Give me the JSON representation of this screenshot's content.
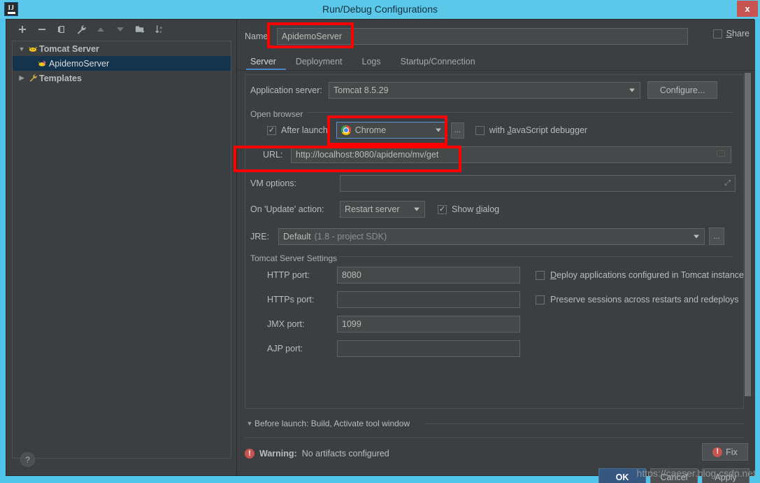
{
  "window": {
    "title": "Run/Debug Configurations",
    "app_icon": "intellij-idea-icon",
    "close_label": "x"
  },
  "left_panel": {
    "toolbar": [
      {
        "name": "add-configuration-button",
        "glyph": "+"
      },
      {
        "name": "remove-configuration-button",
        "glyph": "−"
      },
      {
        "name": "copy-configuration-button",
        "glyph": "copy-icon"
      },
      {
        "name": "edit-templates-button",
        "glyph": "wrench-icon"
      },
      {
        "name": "move-up-button",
        "glyph": "▲"
      },
      {
        "name": "move-down-button",
        "glyph": "▼"
      },
      {
        "name": "new-folder-button",
        "glyph": "folder-plus-icon"
      },
      {
        "name": "sort-configurations-button",
        "glyph": "sort-az-icon"
      }
    ],
    "tree": [
      {
        "label": "Tomcat Server",
        "icon": "tomcat-icon",
        "expander": "▼",
        "level": 0,
        "selected": false,
        "bold": true
      },
      {
        "label": "ApidemoServer",
        "icon": "tomcat-run-icon",
        "expander": "",
        "level": 1,
        "selected": true,
        "bold": false
      },
      {
        "label": "Templates",
        "icon": "wrench-icon",
        "expander": "▶",
        "level": 0,
        "selected": false,
        "bold": true
      }
    ],
    "help_label": "?"
  },
  "right_panel": {
    "name_label": "Name:",
    "name_value": "ApidemoServer",
    "share_label": "Share",
    "share_checked": false,
    "tabs": [
      {
        "label": "Server",
        "active": true
      },
      {
        "label": "Deployment",
        "active": false
      },
      {
        "label": "Logs",
        "active": false
      },
      {
        "label": "Startup/Connection",
        "active": false
      }
    ],
    "application_server": {
      "label": "Application server:",
      "value": "Tomcat 8.5.29",
      "configure_label": "Configure..."
    },
    "open_browser": {
      "group_label": "Open browser",
      "after_launch_label": "After launch",
      "after_launch_checked": true,
      "browser_value": "Chrome",
      "browser_icon": "chrome-icon",
      "ellipsis_label": "...",
      "js_debugger_label": "with JavaScript debugger",
      "js_debugger_checked": false,
      "url_label": "URL:",
      "url_value": "http://localhost:8080/apidemo/mv/get"
    },
    "vm_options": {
      "label": "VM options:",
      "value": ""
    },
    "update_action": {
      "label": "On 'Update' action:",
      "value": "Restart server",
      "show_dialog_label": "Show dialog",
      "show_dialog_checked": true
    },
    "jre": {
      "label": "JRE:",
      "value": "Default",
      "value_hint": "(1.8 - project SDK)",
      "browse_label": "..."
    },
    "tomcat_settings": {
      "group_label": "Tomcat Server Settings",
      "fields": [
        {
          "label": "HTTP port:",
          "value": "8080"
        },
        {
          "label": "HTTPs port:",
          "value": ""
        },
        {
          "label": "JMX port:",
          "value": "1099"
        },
        {
          "label": "AJP port:",
          "value": ""
        }
      ],
      "checkboxes": [
        {
          "label": "Deploy applications configured in Tomcat instance",
          "checked": false
        },
        {
          "label": "Preserve sessions across restarts and redeploys",
          "checked": false
        }
      ]
    },
    "before_launch": {
      "expander": "▼",
      "label": "Before launch: Build, Activate tool window"
    },
    "warning": {
      "prefix": "Warning:",
      "message": "No artifacts configured",
      "fix_label": "Fix"
    },
    "buttons": [
      {
        "label": "OK",
        "primary": true
      },
      {
        "label": "Cancel",
        "primary": false
      },
      {
        "label": "Apply",
        "primary": false
      }
    ]
  },
  "watermark": "https://caeser.blog.csdn.net",
  "colors": {
    "title_bar": "#5bc8ea",
    "panel_bg": "#3c3f41",
    "accent_blue": "#4a88c7",
    "primary_button": "#365880",
    "warning_red": "#c75450",
    "highlight_box": "#ff0000",
    "selection_blue": "#14334c"
  }
}
